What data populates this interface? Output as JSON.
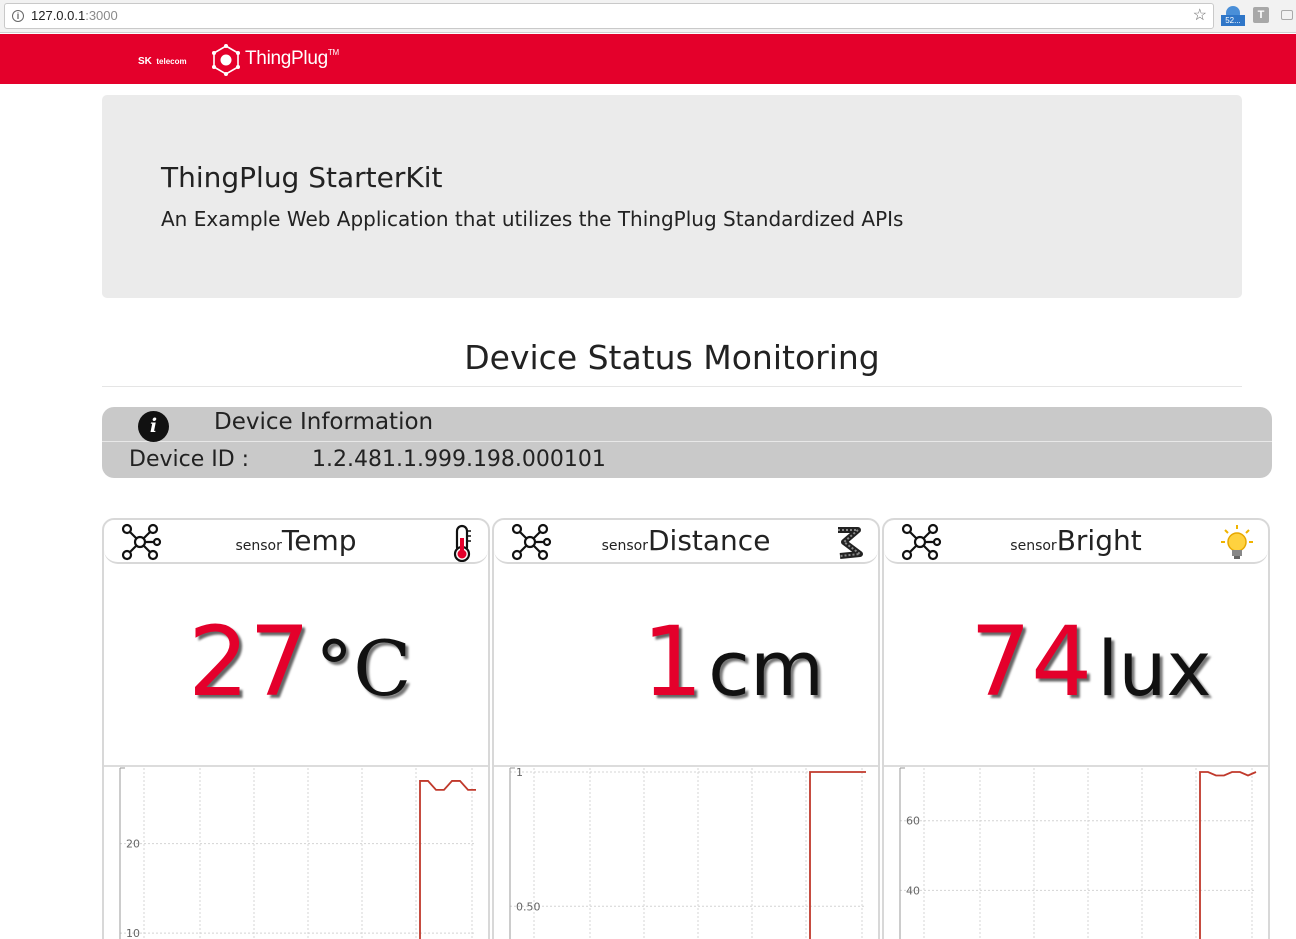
{
  "browser": {
    "url_host": "127.0.0.1",
    "url_port": ":3000",
    "ext_badge": "52...",
    "ext_t": "T"
  },
  "header": {
    "brand_sk": "SK",
    "brand_telecom": "telecom",
    "brand_name": "ThingPlug",
    "brand_tm": "TM",
    "accent_color": "#e4002b"
  },
  "jumbotron": {
    "title": "ThingPlug StarterKit",
    "subtitle": "An Example Web Application that utilizes the ThingPlug Standardized APIs"
  },
  "section": {
    "title": "Device Status Monitoring"
  },
  "device_info": {
    "title": "Device Information",
    "icon": "info-icon",
    "id_label": "Device ID :",
    "id_value": "1.2.481.1.999.198.000101"
  },
  "sensors": [
    {
      "prefix": "sensor",
      "name": "Temp",
      "value": "27",
      "unit": "°C",
      "icon": "thermometer-icon",
      "chart": {
        "yticks": [
          "20",
          "10"
        ],
        "trace": "Temp"
      }
    },
    {
      "prefix": "sensor",
      "name": "Distance",
      "value": "1",
      "unit": "cm",
      "icon": "distance-icon",
      "chart": {
        "yticks": [
          "1",
          "0.50"
        ],
        "trace": "Distance"
      }
    },
    {
      "prefix": "sensor",
      "name": "Bright",
      "value": "74",
      "unit": "lux",
      "icon": "lightbulb-icon",
      "chart": {
        "yticks": [
          "60",
          "40"
        ],
        "trace": "Bright"
      }
    }
  ],
  "chart_data": [
    {
      "type": "line",
      "ytick_values": [
        10,
        20
      ],
      "ylim": [
        7,
        28
      ],
      "grid": true,
      "series": [
        {
          "values": [
            0,
            27,
            27,
            26,
            26,
            27,
            27,
            26,
            26
          ]
        }
      ]
    },
    {
      "type": "line",
      "ytick_values": [
        0.5,
        1
      ],
      "ylim": [
        0.3,
        1
      ],
      "grid": true,
      "series": [
        {
          "values": [
            0,
            1,
            1,
            1,
            1,
            1,
            1,
            1,
            1
          ]
        }
      ]
    },
    {
      "type": "line",
      "ytick_values": [
        40,
        60
      ],
      "ylim": [
        20,
        74
      ],
      "grid": true,
      "series": [
        {
          "values": [
            0,
            74,
            74,
            73,
            73,
            74,
            74,
            73,
            74
          ]
        }
      ]
    }
  ]
}
